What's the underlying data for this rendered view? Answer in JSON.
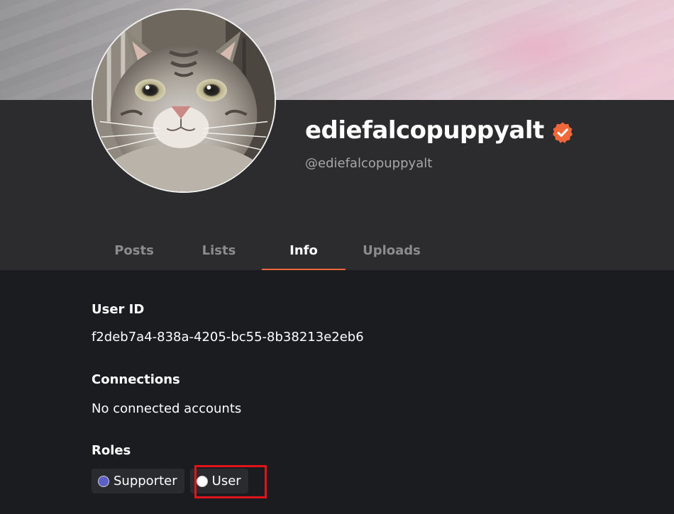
{
  "profile": {
    "display_name": "ediefalcopuppyalt",
    "handle": "@ediefalcopuppyalt",
    "verified": true,
    "verified_color": "#f0683a"
  },
  "tabs": [
    {
      "label": "Posts",
      "active": false
    },
    {
      "label": "Lists",
      "active": false
    },
    {
      "label": "Info",
      "active": true
    },
    {
      "label": "Uploads",
      "active": false
    }
  ],
  "info": {
    "user_id_label": "User ID",
    "user_id_value": "f2deb7a4-838a-4205-bc55-8b38213e2eb6",
    "connections_label": "Connections",
    "connections_value": "No connected accounts",
    "roles_label": "Roles",
    "roles": [
      {
        "name": "Supporter",
        "dot_color": "#5b5fc7"
      },
      {
        "name": "User",
        "dot_color": "#ffffff"
      }
    ]
  },
  "colors": {
    "accent": "#f0683a",
    "highlight_box": "#e0151b",
    "background": "#1b1c1f",
    "header_panel": "#2c2c2e"
  },
  "icons": {
    "verified": "verified-badge-icon",
    "avatar": "cat-avatar"
  }
}
